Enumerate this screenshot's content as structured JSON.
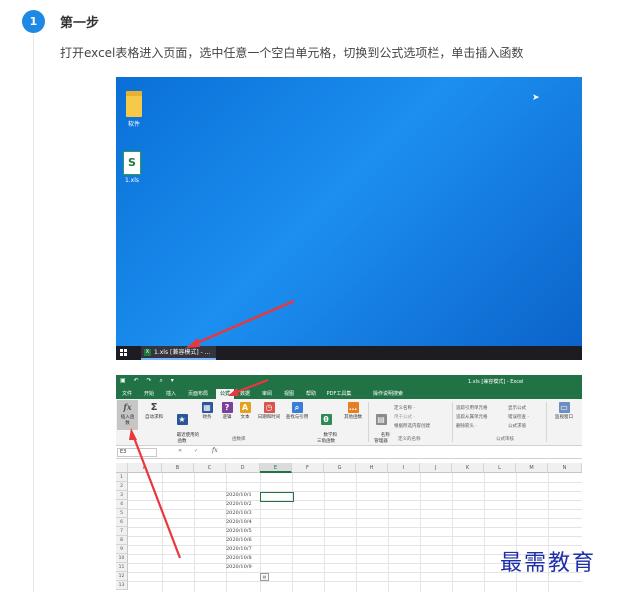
{
  "step": {
    "number": "1",
    "title": "第一步",
    "description": "打开excel表格进入页面，选中任意一个空白单元格，切换到公式选项栏，单击插入函数"
  },
  "desktop": {
    "icons": [
      {
        "label": "软件",
        "type": "folder"
      },
      {
        "label": "1.xls",
        "type": "xls"
      }
    ],
    "taskbar_item": "1.xls [兼容模式] - ..."
  },
  "excel": {
    "title_file": "1.xls [兼容模式] - Excel",
    "tabs": [
      "文件",
      "开始",
      "插入",
      "页面布局",
      "公式",
      "数据",
      "审阅",
      "视图",
      "帮助",
      "PDF工具集",
      "操作说明搜索"
    ],
    "active_tab": "公式",
    "ribbon_buttons": [
      {
        "label": "插入函数",
        "icon": "fx"
      },
      {
        "label": "自动求和",
        "icon": "Σ"
      },
      {
        "label": "最近使用的\n函数",
        "icon": "★"
      },
      {
        "label": "财务",
        "icon": "▦"
      },
      {
        "label": "逻辑",
        "icon": "?"
      },
      {
        "label": "文本",
        "icon": "A"
      },
      {
        "label": "日期和时间",
        "icon": "◷"
      },
      {
        "label": "查找与引用",
        "icon": "⌕"
      },
      {
        "label": "数学和\n三角函数",
        "icon": "θ"
      },
      {
        "label": "其他函数",
        "icon": "…"
      },
      {
        "label": "名称\n管理器",
        "icon": "▤"
      }
    ],
    "group_labels": [
      "函数库",
      "定义的名称",
      "公式审核"
    ],
    "defined_names": [
      "定义名称 ·",
      "用于公式 ·",
      "根据所选内容创建"
    ],
    "audit_items": [
      "追踪引用单元格",
      "追踪从属单元格",
      "删除箭头 ·",
      "显示公式",
      "错误检查 ·",
      "公式求值"
    ],
    "watch_window": "监视窗口",
    "name_box": "E3",
    "formula_symbol": "fx",
    "columns": [
      "A",
      "B",
      "C",
      "D",
      "E",
      "F",
      "G",
      "H",
      "I",
      "J",
      "K",
      "L",
      "M",
      "N"
    ],
    "rows": [
      "1",
      "2",
      "3",
      "4",
      "5",
      "6",
      "7",
      "8",
      "9",
      "10",
      "11",
      "12",
      "13"
    ],
    "dates": [
      "2020/10/1",
      "2020/10/2",
      "2020/10/3",
      "2020/10/4",
      "2020/10/5",
      "2020/10/6",
      "2020/10/7",
      "2020/10/8",
      "2020/10/9"
    ]
  },
  "watermark": "最需教育",
  "colors": {
    "badge": "#1e88e5",
    "excel_green": "#217346",
    "arrow": "#e8383d",
    "watermark": "#1e2fa8"
  }
}
